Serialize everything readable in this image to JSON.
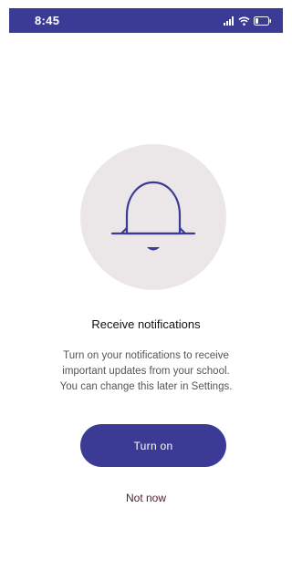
{
  "status_bar": {
    "time": "8:45",
    "icons": [
      "signal-icon",
      "wifi-icon",
      "battery-icon"
    ]
  },
  "colors": {
    "brand": "#3b3b96",
    "circle_bg": "#ebe7e8",
    "link": "#4a1f2a"
  },
  "main": {
    "icon": "bell-icon",
    "title": "Receive notifications",
    "description": "Turn on your notifications to receive\nimportant updates from your school.\nYou can change this later in Settings.",
    "primary_button_label": "Turn on",
    "secondary_link_label": "Not now"
  }
}
